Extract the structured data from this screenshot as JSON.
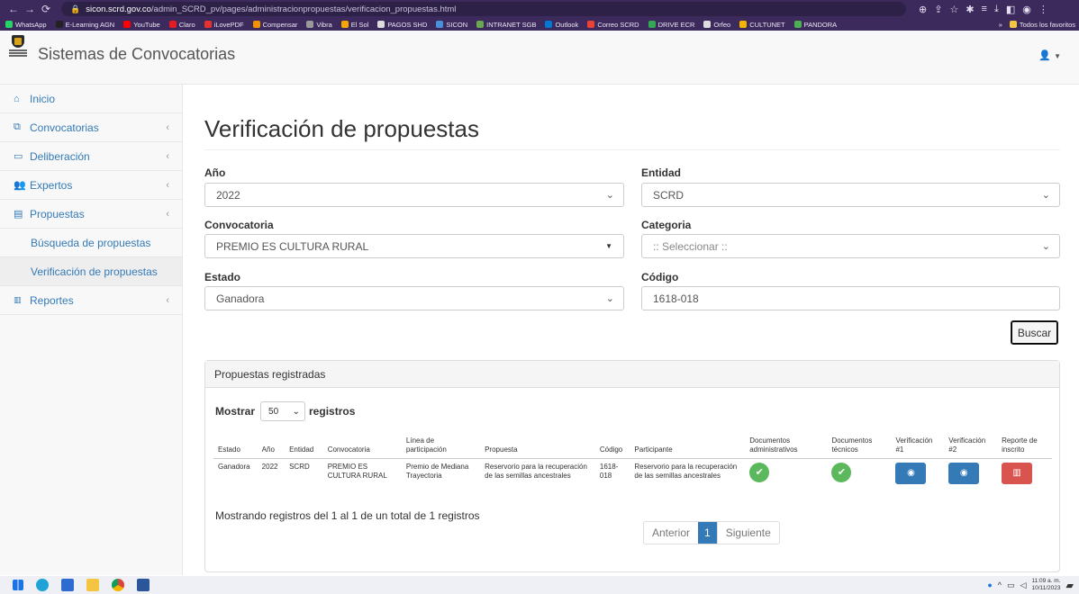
{
  "browser": {
    "url_host": "sicon.scrd.gov.co",
    "url_path": "/admin_SCRD_pv/pages/administracionpropuestas/verificacion_propuestas.html",
    "bookmarks": [
      {
        "label": "WhatsApp",
        "color": "#25d366"
      },
      {
        "label": "E-Learning AGN",
        "color": "#222222"
      },
      {
        "label": "YouTube",
        "color": "#ff0000"
      },
      {
        "label": "Claro",
        "color": "#e31b23"
      },
      {
        "label": "iLovePDF",
        "color": "#e5322d"
      },
      {
        "label": "Compensar",
        "color": "#f39200"
      },
      {
        "label": "Vibra",
        "color": "#999999"
      },
      {
        "label": "El Sol",
        "color": "#f7a600"
      },
      {
        "label": "PAGOS SHD",
        "color": "#dddddd"
      },
      {
        "label": "SICON",
        "color": "#4a90d9"
      },
      {
        "label": "INTRANET SGB",
        "color": "#6aa84f"
      },
      {
        "label": "Outlook",
        "color": "#0078d4"
      },
      {
        "label": "Correo SCRD",
        "color": "#ea4335"
      },
      {
        "label": "DRIVE ECR",
        "color": "#34a853"
      },
      {
        "label": "Orfeo",
        "color": "#dddddd"
      },
      {
        "label": "CULTUNET",
        "color": "#f4b400"
      },
      {
        "label": "PANDORA",
        "color": "#4caf50"
      }
    ],
    "bookmarks_more": "»",
    "all_bookmarks": "Todos los favoritos"
  },
  "app": {
    "title": "Sistemas de Convocatorias"
  },
  "sidebar": {
    "items": [
      {
        "label": "Inicio",
        "icon": "home-icon"
      },
      {
        "label": "Convocatorias",
        "icon": "copy-icon"
      },
      {
        "label": "Deliberación",
        "icon": "folder-icon"
      },
      {
        "label": "Expertos",
        "icon": "users-icon"
      },
      {
        "label": "Propuestas",
        "icon": "file-icon"
      },
      {
        "label": "Búsqueda de propuestas"
      },
      {
        "label": "Verificación de propuestas"
      },
      {
        "label": "Reportes",
        "icon": "bar-chart-icon"
      }
    ]
  },
  "page": {
    "title": "Verificación de propuestas"
  },
  "filters": {
    "anio_label": "Año",
    "anio_value": "2022",
    "entidad_label": "Entidad",
    "entidad_value": "SCRD",
    "convocatoria_label": "Convocatoria",
    "convocatoria_value": "PREMIO ES CULTURA RURAL",
    "categoria_label": "Categoria",
    "categoria_value": ":: Seleccionar ::",
    "estado_label": "Estado",
    "estado_value": "Ganadora",
    "codigo_label": "Código",
    "codigo_value": "1618-018",
    "search_button": "Buscar"
  },
  "panel": {
    "title": "Propuestas registradas",
    "show_label": "Mostrar",
    "page_length": "50",
    "records_label": "registros",
    "columns": [
      "Estado",
      "Año",
      "Entidad",
      "Convocatoria",
      "Línea de participación",
      "Propuesta",
      "Código",
      "Participante",
      "Documentos administrativos",
      "Documentos técnicos",
      "Verificación #1",
      "Verificación #2",
      "Reporte de inscrito"
    ],
    "rows": [
      {
        "estado": "Ganadora",
        "anio": "2022",
        "entidad": "SCRD",
        "convocatoria": "PREMIO ES CULTURA RURAL",
        "linea": "Premio de Mediana Trayectoria",
        "propuesta": "Reservorio para la recuperación de las semillas ancestrales",
        "codigo": "1618-018",
        "participante": "Reservorio para la recuperación de las semillas ancestrales"
      }
    ],
    "info": "Mostrando registros del 1 al 1 de un total de 1 registros",
    "prev": "Anterior",
    "current_page": "1",
    "next": "Siguiente"
  },
  "taskbar": {
    "time": "11:09 a. m.",
    "date": "10/11/2023"
  },
  "colors": {
    "link": "#337ab7",
    "success": "#5cb85c",
    "primary": "#337ab7",
    "danger": "#d9534f",
    "browser_chrome": "#3c2a5c"
  }
}
